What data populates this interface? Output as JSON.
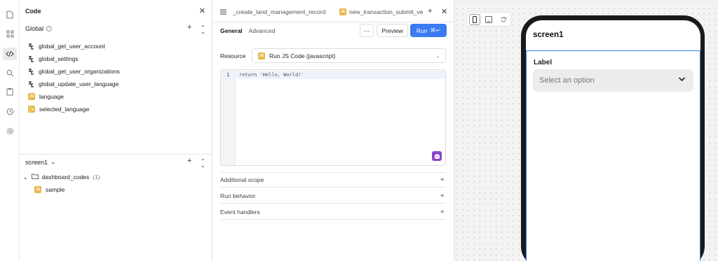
{
  "code_panel": {
    "title": "Code",
    "global_label": "Global",
    "queries": [
      {
        "name": "global_get_user_account",
        "kind": "query"
      },
      {
        "name": "global_settings",
        "kind": "query"
      },
      {
        "name": "global_get_user_organizations",
        "kind": "query"
      },
      {
        "name": "global_update_user_language",
        "kind": "query"
      },
      {
        "name": "language",
        "kind": "js"
      },
      {
        "name": "selected_language",
        "kind": "variable"
      }
    ],
    "screen_selector": "screen1",
    "folder": {
      "name": "dashboard_codes",
      "count": "(1)"
    },
    "folder_items": [
      {
        "name": "sample",
        "kind": "js"
      }
    ],
    "js_badge": "JS",
    "var_badge": "ƒx"
  },
  "editor": {
    "tabs": [
      {
        "label": "_create_land_management_record"
      },
      {
        "label": "new_transaction_submit_ve"
      }
    ],
    "subtabs": {
      "general": "General",
      "advanced": "Advanced"
    },
    "more_label": "···",
    "preview_label": "Preview",
    "run_label": "Run",
    "run_shortcut": "⌘↩",
    "resource_label": "Resource",
    "resource_value": "Run JS Code (javascript)",
    "code_line_number": "1",
    "code_text": "return 'Hello, World!'",
    "sections": [
      "Additional scope",
      "Run behavior",
      "Event handlers"
    ]
  },
  "canvas": {
    "screen_title": "screen1",
    "field_label": "Label",
    "select_placeholder": "Select an option"
  },
  "colors": {
    "accent": "#3b7af0",
    "js_badge": "#e8b84a",
    "ai_badge": "#8a45c9"
  }
}
